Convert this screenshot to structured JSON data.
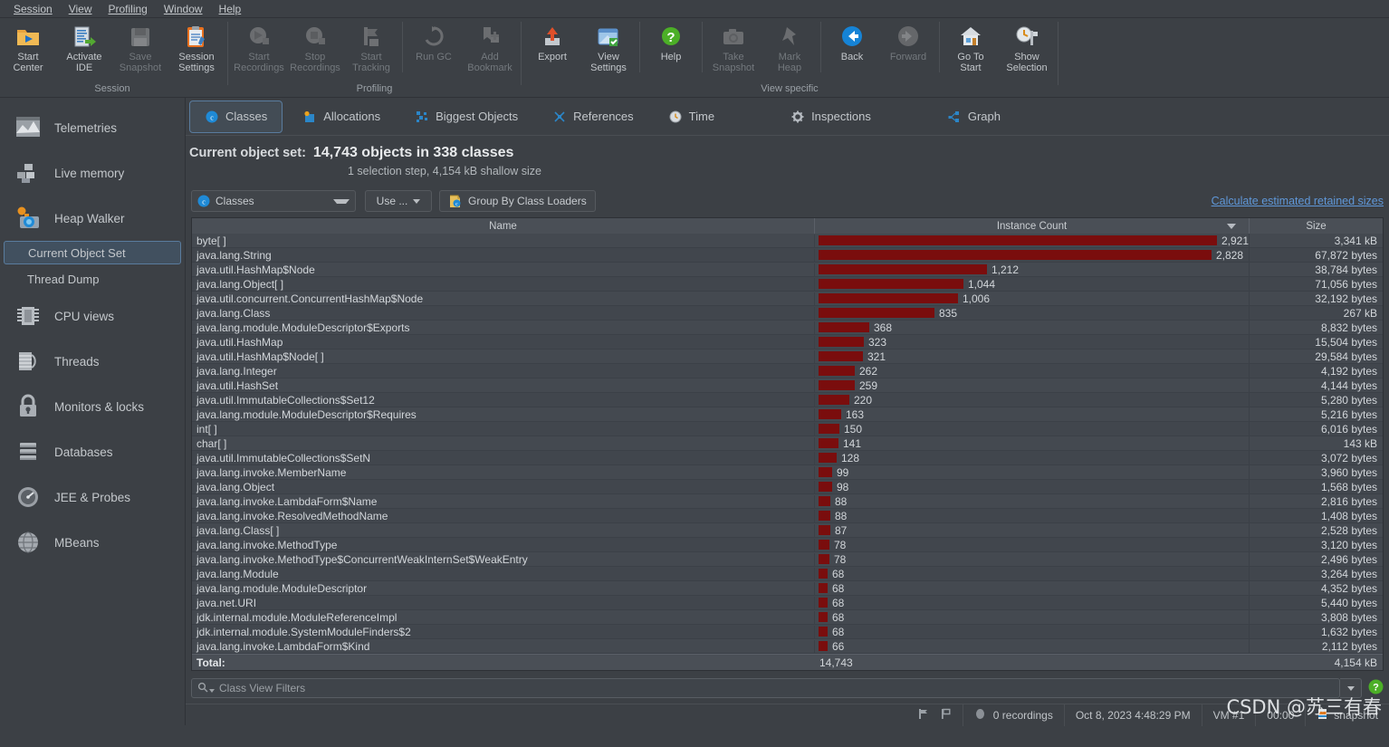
{
  "menubar": {
    "items": [
      "Session",
      "View",
      "Profiling",
      "Window",
      "Help"
    ]
  },
  "toolbar": {
    "groups": [
      {
        "name": "Session",
        "buttons": [
          {
            "label": "Start\nCenter",
            "icon": "start-center-icon",
            "disabled": false
          },
          {
            "label": "Activate\nIDE",
            "icon": "activate-ide-icon",
            "disabled": false
          },
          {
            "label": "Save\nSnapshot",
            "icon": "save-snapshot-icon",
            "disabled": true
          },
          {
            "label": "Session\nSettings",
            "icon": "session-settings-icon",
            "disabled": false
          }
        ]
      },
      {
        "name": "Profiling",
        "buttons": [
          {
            "label": "Start\nRecordings",
            "icon": "start-recordings-icon",
            "disabled": true
          },
          {
            "label": "Stop\nRecordings",
            "icon": "stop-recordings-icon",
            "disabled": true
          },
          {
            "label": "Start\nTracking",
            "icon": "start-tracking-icon",
            "disabled": true
          },
          {
            "label": "Run GC",
            "icon": "run-gc-icon",
            "disabled": true
          },
          {
            "label": "Add\nBookmark",
            "icon": "add-bookmark-icon",
            "disabled": true
          }
        ]
      },
      {
        "name": "View specific",
        "buttons": [
          {
            "label": "Export",
            "icon": "export-icon",
            "disabled": false
          },
          {
            "label": "View\nSettings",
            "icon": "view-settings-icon",
            "disabled": false
          },
          {
            "label": "Help",
            "icon": "help-icon",
            "disabled": false
          },
          {
            "label": "Take\nSnapshot",
            "icon": "take-snapshot-icon",
            "disabled": true
          },
          {
            "label": "Mark\nHeap",
            "icon": "mark-heap-icon",
            "disabled": true
          },
          {
            "label": "Back",
            "icon": "back-arrow-icon",
            "disabled": false
          },
          {
            "label": "Forward",
            "icon": "forward-arrow-icon",
            "disabled": true
          },
          {
            "label": "Go To\nStart",
            "icon": "go-to-start-icon",
            "disabled": false
          },
          {
            "label": "Show\nSelection",
            "icon": "show-selection-icon",
            "disabled": false
          }
        ]
      }
    ]
  },
  "sidebar": {
    "items": [
      {
        "label": "Telemetries",
        "icon": "telemetries-icon"
      },
      {
        "label": "Live memory",
        "icon": "live-memory-icon"
      },
      {
        "label": "Heap Walker",
        "icon": "heap-walker-icon"
      }
    ],
    "subitems": [
      {
        "label": "Current Object Set",
        "selected": true
      },
      {
        "label": "Thread Dump",
        "selected": false
      }
    ],
    "items2": [
      {
        "label": "CPU views",
        "icon": "cpu-views-icon"
      },
      {
        "label": "Threads",
        "icon": "threads-icon"
      },
      {
        "label": "Monitors & locks",
        "icon": "monitors-locks-icon"
      },
      {
        "label": "Databases",
        "icon": "databases-icon"
      },
      {
        "label": "JEE & Probes",
        "icon": "jee-probes-icon"
      },
      {
        "label": "MBeans",
        "icon": "mbeans-icon"
      }
    ]
  },
  "tabs": [
    {
      "label": "Classes",
      "icon": "classes-icon",
      "active": true
    },
    {
      "label": "Allocations",
      "icon": "allocations-icon",
      "active": false
    },
    {
      "label": "Biggest Objects",
      "icon": "biggest-objects-icon",
      "active": false
    },
    {
      "label": "References",
      "icon": "references-icon",
      "active": false
    },
    {
      "label": "Time",
      "icon": "time-icon",
      "active": false
    },
    {
      "label": "Inspections",
      "icon": "inspections-icon",
      "active": false
    },
    {
      "label": "Graph",
      "icon": "graph-icon",
      "active": false
    }
  ],
  "headline": {
    "label": "Current object set:",
    "value": "14,743 objects in 338 classes",
    "subtitle": "1 selection step, 4,154 kB shallow size"
  },
  "controls": {
    "classes_combo": "Classes",
    "use_combo": "Use ...",
    "group_by_class_loaders": "Group By Class Loaders",
    "retained_sizes_link": "Calculate estimated retained sizes"
  },
  "table": {
    "headers": [
      "Name",
      "Instance Count",
      "Size"
    ],
    "sorted_column": "Instance Count",
    "sort_direction": "desc",
    "bar_color": "#7a0d0d",
    "max_count": 2921,
    "rows": [
      {
        "name": "byte[ ]",
        "count": 2921,
        "count_label": "2,921",
        "size": "3,341 kB"
      },
      {
        "name": "java.lang.String",
        "count": 2828,
        "count_label": "2,828",
        "size": "67,872 bytes"
      },
      {
        "name": "java.util.HashMap$Node",
        "count": 1212,
        "count_label": "1,212",
        "size": "38,784 bytes"
      },
      {
        "name": "java.lang.Object[ ]",
        "count": 1044,
        "count_label": "1,044",
        "size": "71,056 bytes"
      },
      {
        "name": "java.util.concurrent.ConcurrentHashMap$Node",
        "count": 1006,
        "count_label": "1,006",
        "size": "32,192 bytes"
      },
      {
        "name": "java.lang.Class",
        "count": 835,
        "count_label": "835",
        "size": "267 kB"
      },
      {
        "name": "java.lang.module.ModuleDescriptor$Exports",
        "count": 368,
        "count_label": "368",
        "size": "8,832 bytes"
      },
      {
        "name": "java.util.HashMap",
        "count": 323,
        "count_label": "323",
        "size": "15,504 bytes"
      },
      {
        "name": "java.util.HashMap$Node[ ]",
        "count": 321,
        "count_label": "321",
        "size": "29,584 bytes"
      },
      {
        "name": "java.lang.Integer",
        "count": 262,
        "count_label": "262",
        "size": "4,192 bytes"
      },
      {
        "name": "java.util.HashSet",
        "count": 259,
        "count_label": "259",
        "size": "4,144 bytes"
      },
      {
        "name": "java.util.ImmutableCollections$Set12",
        "count": 220,
        "count_label": "220",
        "size": "5,280 bytes"
      },
      {
        "name": "java.lang.module.ModuleDescriptor$Requires",
        "count": 163,
        "count_label": "163",
        "size": "5,216 bytes"
      },
      {
        "name": "int[ ]",
        "count": 150,
        "count_label": "150",
        "size": "6,016 bytes"
      },
      {
        "name": "char[ ]",
        "count": 141,
        "count_label": "141",
        "size": "143 kB"
      },
      {
        "name": "java.util.ImmutableCollections$SetN",
        "count": 128,
        "count_label": "128",
        "size": "3,072 bytes"
      },
      {
        "name": "java.lang.invoke.MemberName",
        "count": 99,
        "count_label": "99",
        "size": "3,960 bytes"
      },
      {
        "name": "java.lang.Object",
        "count": 98,
        "count_label": "98",
        "size": "1,568 bytes"
      },
      {
        "name": "java.lang.invoke.LambdaForm$Name",
        "count": 88,
        "count_label": "88",
        "size": "2,816 bytes"
      },
      {
        "name": "java.lang.invoke.ResolvedMethodName",
        "count": 88,
        "count_label": "88",
        "size": "1,408 bytes"
      },
      {
        "name": "java.lang.Class[ ]",
        "count": 87,
        "count_label": "87",
        "size": "2,528 bytes"
      },
      {
        "name": "java.lang.invoke.MethodType",
        "count": 78,
        "count_label": "78",
        "size": "3,120 bytes"
      },
      {
        "name": "java.lang.invoke.MethodType$ConcurrentWeakInternSet$WeakEntry",
        "count": 78,
        "count_label": "78",
        "size": "2,496 bytes"
      },
      {
        "name": "java.lang.Module",
        "count": 68,
        "count_label": "68",
        "size": "3,264 bytes"
      },
      {
        "name": "java.lang.module.ModuleDescriptor",
        "count": 68,
        "count_label": "68",
        "size": "4,352 bytes"
      },
      {
        "name": "java.net.URI",
        "count": 68,
        "count_label": "68",
        "size": "5,440 bytes"
      },
      {
        "name": "jdk.internal.module.ModuleReferenceImpl",
        "count": 68,
        "count_label": "68",
        "size": "3,808 bytes"
      },
      {
        "name": "jdk.internal.module.SystemModuleFinders$2",
        "count": 68,
        "count_label": "68",
        "size": "1,632 bytes"
      },
      {
        "name": "java.lang.invoke.LambdaForm$Kind",
        "count": 66,
        "count_label": "66",
        "size": "2,112 bytes"
      }
    ],
    "total": {
      "label": "Total:",
      "count": "14,743",
      "size": "4,154 kB"
    }
  },
  "bottom_filter": {
    "placeholder": "Class View Filters",
    "icon": "search-icon"
  },
  "statusbar": {
    "recordings": "0 recordings",
    "timestamp": "Oct 8, 2023 4:48:29 PM",
    "vm": "VM #1",
    "elapsed": "00:00",
    "snapshot": "snapshot"
  },
  "watermark": "CSDN @苏三有春"
}
